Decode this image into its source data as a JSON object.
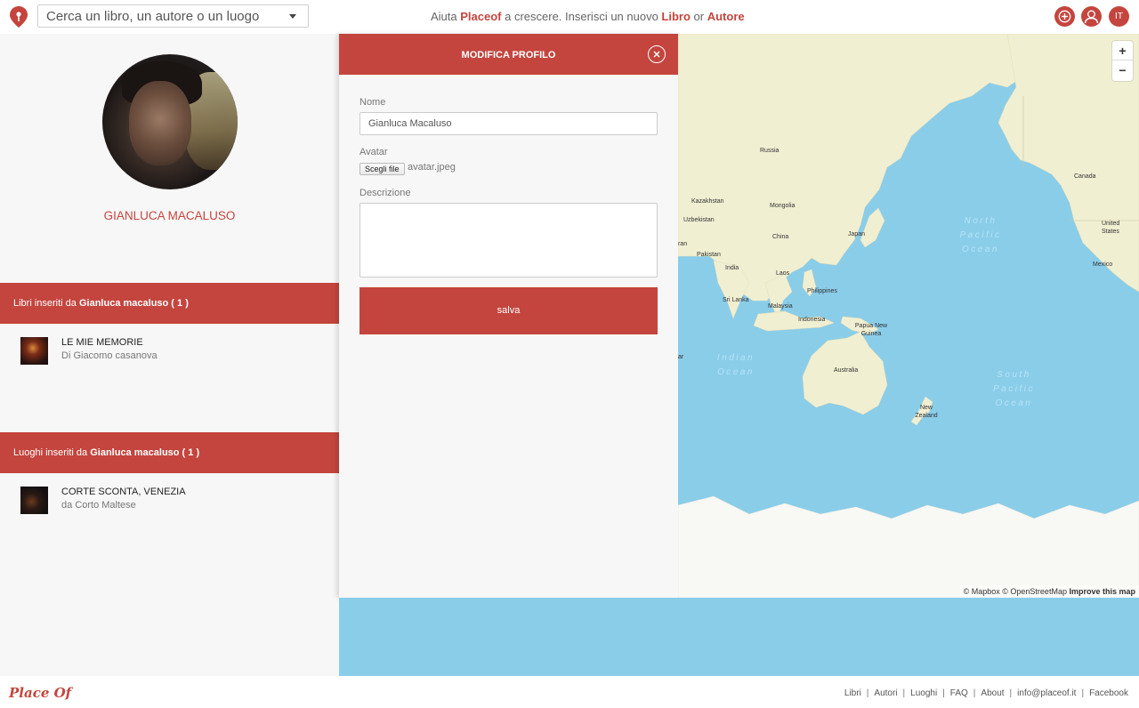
{
  "search": {
    "placeholder": "Cerca un libro, un autore o un luogo"
  },
  "tagline": {
    "prefix": "Aiuta ",
    "brand": "Placeof",
    "middle": " a crescere. Inserisci un nuovo ",
    "book": "Libro",
    "or": " or ",
    "author": "Autore"
  },
  "header": {
    "lang": "IT",
    "icons": [
      "add-icon",
      "user-icon"
    ]
  },
  "profile": {
    "name": "GIANLUCA MACALUSO",
    "books_section": {
      "prefix": "Libri inseriti da ",
      "user": "Gianluca macaluso",
      "count": " ( 1 )"
    },
    "books": [
      {
        "title": "LE MIE MEMORIE",
        "subtitle": "Di Giacomo casanova"
      }
    ],
    "places_section": {
      "prefix": "Luoghi inseriti da ",
      "user": "Gianluca macaluso",
      "count": " ( 1 )"
    },
    "places": [
      {
        "title": "CORTE SCONTA, VENEZIA",
        "subtitle": "da Corto Maltese"
      }
    ]
  },
  "edit": {
    "title": "MODIFICA PROFILO",
    "name_label": "Nome",
    "name_value": "Gianluca Macaluso",
    "avatar_label": "Avatar",
    "file_button": "Scegli file",
    "file_name": "avatar.jpeg",
    "description_label": "Descrizione",
    "description_value": "",
    "save": "salva"
  },
  "map": {
    "labels": {
      "russia": "Russia",
      "canada": "Canada",
      "kazakhstan": "Kazakhstan",
      "mongolia": "Mongolia",
      "uzbekistan": "Uzbekistan",
      "china": "China",
      "japan": "Japan",
      "iran": "ran",
      "pakistan": "Pakistan",
      "india": "India",
      "laos": "Laos",
      "philippines": "Philippines",
      "srilanka": "Sri Lanka",
      "malaysia": "Malaysia",
      "indonesia": "Indonesia",
      "png": "Papua New Guinea",
      "australia": "Australia",
      "newzealand": "New Zealand",
      "us": "United States",
      "mexico": "Mexico",
      "ar": "ar"
    },
    "oceans": {
      "north_pacific": "North Pacific Ocean",
      "indian": "Indian Ocean",
      "south_pacific": "South Pacific Ocean"
    },
    "zoom_in": "+",
    "zoom_out": "−",
    "attribution": {
      "mapbox": "© Mapbox",
      "osm": "© OpenStreetMap",
      "improve": "Improve this map"
    },
    "colors": {
      "water": "#8acde9",
      "land": "#f1efd2",
      "ice": "#f8f8f4"
    }
  },
  "footer": {
    "logo": "Place Of",
    "links": [
      "Libri",
      "Autori",
      "Luoghi",
      "FAQ",
      "About",
      "info@placeof.it",
      "Facebook"
    ]
  },
  "colors": {
    "accent": "#c4453e",
    "panel": "#f7f7f7"
  }
}
